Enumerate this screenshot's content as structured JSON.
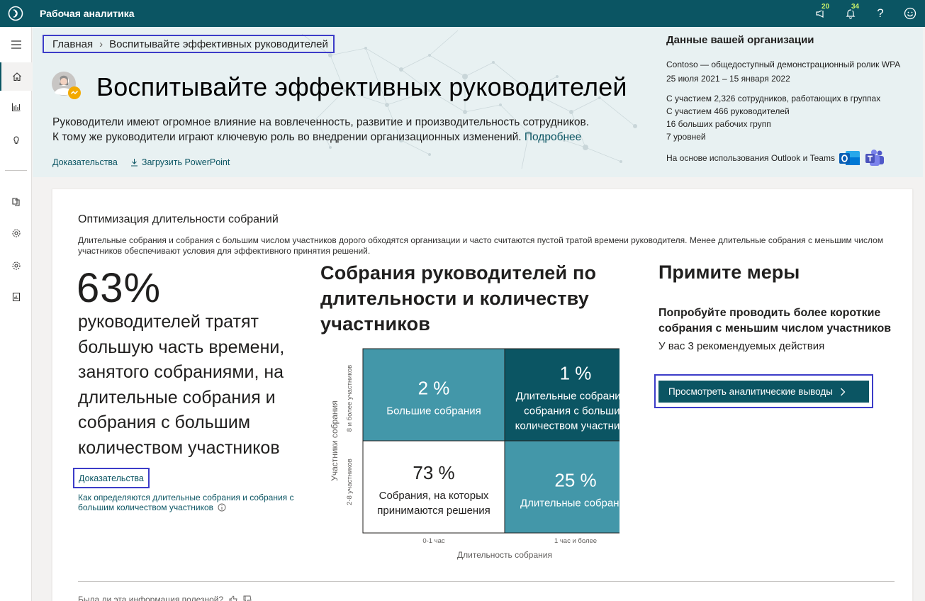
{
  "app": {
    "title": "Рабочая аналитика"
  },
  "topbar": {
    "notifications": {
      "announcements_count": "20",
      "alerts_count": "34"
    },
    "help": "?"
  },
  "breadcrumb": {
    "home": "Главная",
    "current": "Воспитывайте эффективных руководителей"
  },
  "page": {
    "title": "Воспитывайте эффективных руководителей",
    "description_1": "Руководители имеют огромное влияние на вовлеченность, развитие и производительность сотрудников.",
    "description_2": "К тому же руководители играют ключевую роль во внедрении организационных изменений.",
    "learn_more": "Подробнее",
    "evidence_link": "Доказательства",
    "download_ppt": "Загрузить PowerPoint"
  },
  "org": {
    "title": "Данные вашей организации",
    "name": "Contoso — общедоступный демонстрационный ролик WPA",
    "date_range": "25 июля 2021 – 15 января 2022",
    "stats": [
      "С участием 2,326 сотрудников, работающих в группах",
      "С участием 466 руководителей",
      "16 больших рабочих групп",
      "7 уровней"
    ],
    "basis": "На основе использования Outlook и Teams"
  },
  "card": {
    "title": "Оптимизация длительности собраний",
    "description": "Длительные собрания и собрания с большим числом участников дорого обходятся организации и часто считаются пустой тратой времени руководителя. Менее длительные собрания с меньшим числом участников обеспечивают условия для эффективного принятия решений.",
    "big_stat": "63%",
    "big_stat_text": "руководителей тратят большую часть времени, занятого собраниями, на длительные собрания и собрания с большим количеством участников",
    "evidence": "Доказательства",
    "how_defined": "Как определяются длительные собрания и собрания с большим количеством участников"
  },
  "chart_data": {
    "type": "heatmap",
    "title": "Собрания руководителей по длительности и количеству участников",
    "xlabel": "Длительность собрания",
    "ylabel": "Участники собрания",
    "x_categories": [
      "0-1 час",
      "1 час и более"
    ],
    "y_categories": [
      "8 и более участников",
      "2-8 участников"
    ],
    "cells": [
      {
        "row": 0,
        "col": 0,
        "value": "2 %",
        "label": "Большие собрания",
        "color": "#4397a9",
        "text_color": "#ffffff"
      },
      {
        "row": 0,
        "col": 1,
        "value": "1 %",
        "label": "Длительные собрания и собрания с большим количеством участников",
        "color": "#0b5563",
        "text_color": "#ffffff"
      },
      {
        "row": 1,
        "col": 0,
        "value": "73 %",
        "label": "Собрания, на которых принимаются решения",
        "color": "#ffffff",
        "text_color": "#201f1e"
      },
      {
        "row": 1,
        "col": 1,
        "value": "25 %",
        "label": "Длительные собрания",
        "color": "#4397a9",
        "text_color": "#ffffff"
      }
    ]
  },
  "actions": {
    "title": "Примите меры",
    "subtitle": "Попробуйте проводить более короткие собрания с меньшим числом участников",
    "count_text": "У вас 3 рекомендуемых действия",
    "insights_button": "Просмотреть аналитические выводы"
  },
  "feedback": {
    "question": "Была ли эта информация полезной?"
  },
  "colors": {
    "brand": "#0b5563",
    "accent_light": "#4397a9",
    "focus_outline": "#3c3cc8"
  }
}
